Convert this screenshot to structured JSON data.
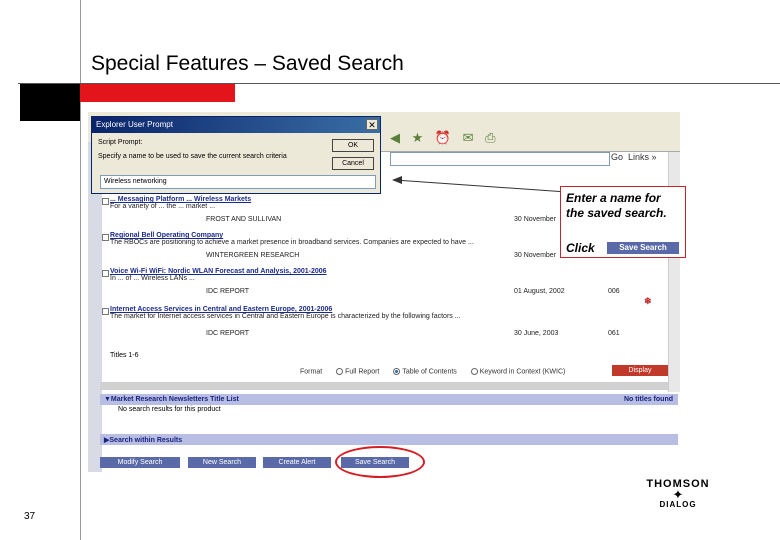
{
  "slide": {
    "title": "Special Features – Saved Search",
    "page_number": "37",
    "colors": {
      "accent_red": "#e3151a",
      "black": "#000000"
    }
  },
  "dialog": {
    "title": "Explorer User Prompt",
    "close": "✕",
    "script_prompt": "Script Prompt:",
    "instruction": "Specify a name to be used to save the current search criteria",
    "ok": "OK",
    "cancel": "Cancel",
    "input_value": "Wireless networking"
  },
  "browser": {
    "toolbar_icons": [
      "back-icon",
      "favorites-icon",
      "history-icon",
      "mail-icon",
      "print-icon"
    ],
    "go": "Go",
    "links": "Links »"
  },
  "results": [
    {
      "title": "... Messaging Platform ... Wireless Markets",
      "snippet": "For a variety of ... the ... market ...",
      "publisher": "FROST AND SULLIVAN",
      "date": "30 November",
      "pages": ""
    },
    {
      "title": "Regional Bell Operating Company",
      "snippet": "The RBOCs are positioning to achieve a market presence in broadband services. Companies are expected to have ...",
      "publisher": "WINTERGREEN RESEARCH",
      "date": "30 November",
      "pages": ""
    },
    {
      "title": "Voice Wi-Fi WiFi: Nordic WLAN Forecast and Analysis, 2001-2006",
      "snippet": "In ... of ... Wireless LANs ...",
      "publisher": "IDC REPORT",
      "date": "01 August, 2002",
      "pages": "006"
    },
    {
      "title": "Internet Access Services in Central and Eastern Europe, 2001-2006",
      "snippet": "The market for Internet access services in Central and Eastern Europe is characterized by the following factors ...",
      "publisher": "IDC REPORT",
      "date": "30 June, 2003",
      "pages": "061"
    }
  ],
  "list_footer": {
    "titles": "Titles 1-6",
    "format_label": "Format",
    "options": [
      "Full Report",
      "Table of Contents",
      "Keyword in Context (KWIC)"
    ],
    "selected_option": "Table of Contents",
    "display": "Display"
  },
  "newsletters": {
    "header": "▼Market Research Newsletters Title List",
    "no_titles": "No titles found",
    "no_results": "No search results for this product"
  },
  "search_within": {
    "header": "▶Search within Results"
  },
  "nav_buttons": [
    "Modify Search",
    "New Search",
    "Create Alert",
    "Save Search"
  ],
  "callout": {
    "line1": "Enter a name for",
    "line2": "the saved search.",
    "click": "Click",
    "button": "Save Search"
  },
  "logo": {
    "top": "THOMSON",
    "bottom": "DIALOG"
  }
}
